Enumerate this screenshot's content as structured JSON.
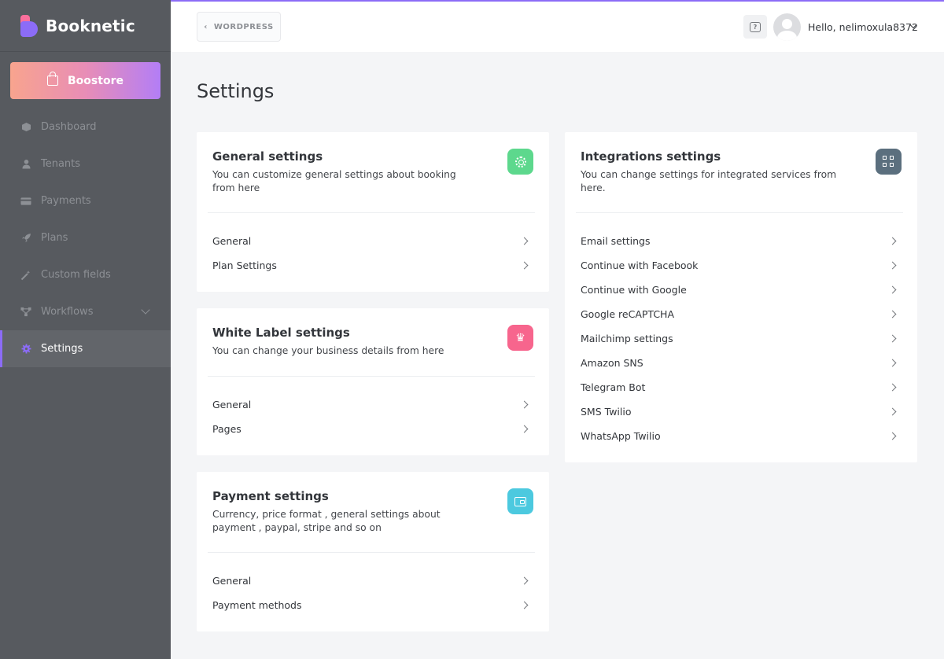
{
  "brand": {
    "name": "Booknetic"
  },
  "sidebar": {
    "boostore_label": "Boostore",
    "items": [
      {
        "label": "Dashboard",
        "icon": "dashboard-icon"
      },
      {
        "label": "Tenants",
        "icon": "user-icon"
      },
      {
        "label": "Payments",
        "icon": "credit-card-icon"
      },
      {
        "label": "Plans",
        "icon": "rocket-icon"
      },
      {
        "label": "Custom fields",
        "icon": "wand-icon"
      },
      {
        "label": "Workflows",
        "icon": "workflow-icon"
      },
      {
        "label": "Settings",
        "icon": "gear-icon",
        "active": true
      }
    ]
  },
  "topbar": {
    "wordpress_label": "WORDPRESS",
    "greeting": "Hello, nelimoxula8372"
  },
  "page": {
    "title": "Settings"
  },
  "cards": {
    "general": {
      "title": "General settings",
      "desc": "You can customize general settings about booking from here",
      "items": [
        "General",
        "Plan Settings"
      ]
    },
    "white_label": {
      "title": "White Label settings",
      "desc": "You can change your business details from here",
      "items": [
        "General",
        "Pages"
      ]
    },
    "payment": {
      "title": "Payment settings",
      "desc": "Currency, price format , general settings about payment , paypal, stripe and so on",
      "items": [
        "General",
        "Payment methods"
      ]
    },
    "integrations": {
      "title": "Integrations settings",
      "desc": "You can change settings for integrated services from here.",
      "items": [
        "Email settings",
        "Continue with Facebook",
        "Continue with Google",
        "Google reCAPTCHA",
        "Mailchimp settings",
        "Amazon SNS",
        "Telegram Bot",
        "SMS Twilio",
        "WhatsApp Twilio"
      ]
    }
  },
  "colors": {
    "accent": "#8c6cf7",
    "sidebar_bg": "#575a5f",
    "general_icon": "#5dd88d",
    "white_label_icon": "#f7658d",
    "payment_icon": "#4cc9df",
    "integrations_icon": "#5b6f7e"
  }
}
